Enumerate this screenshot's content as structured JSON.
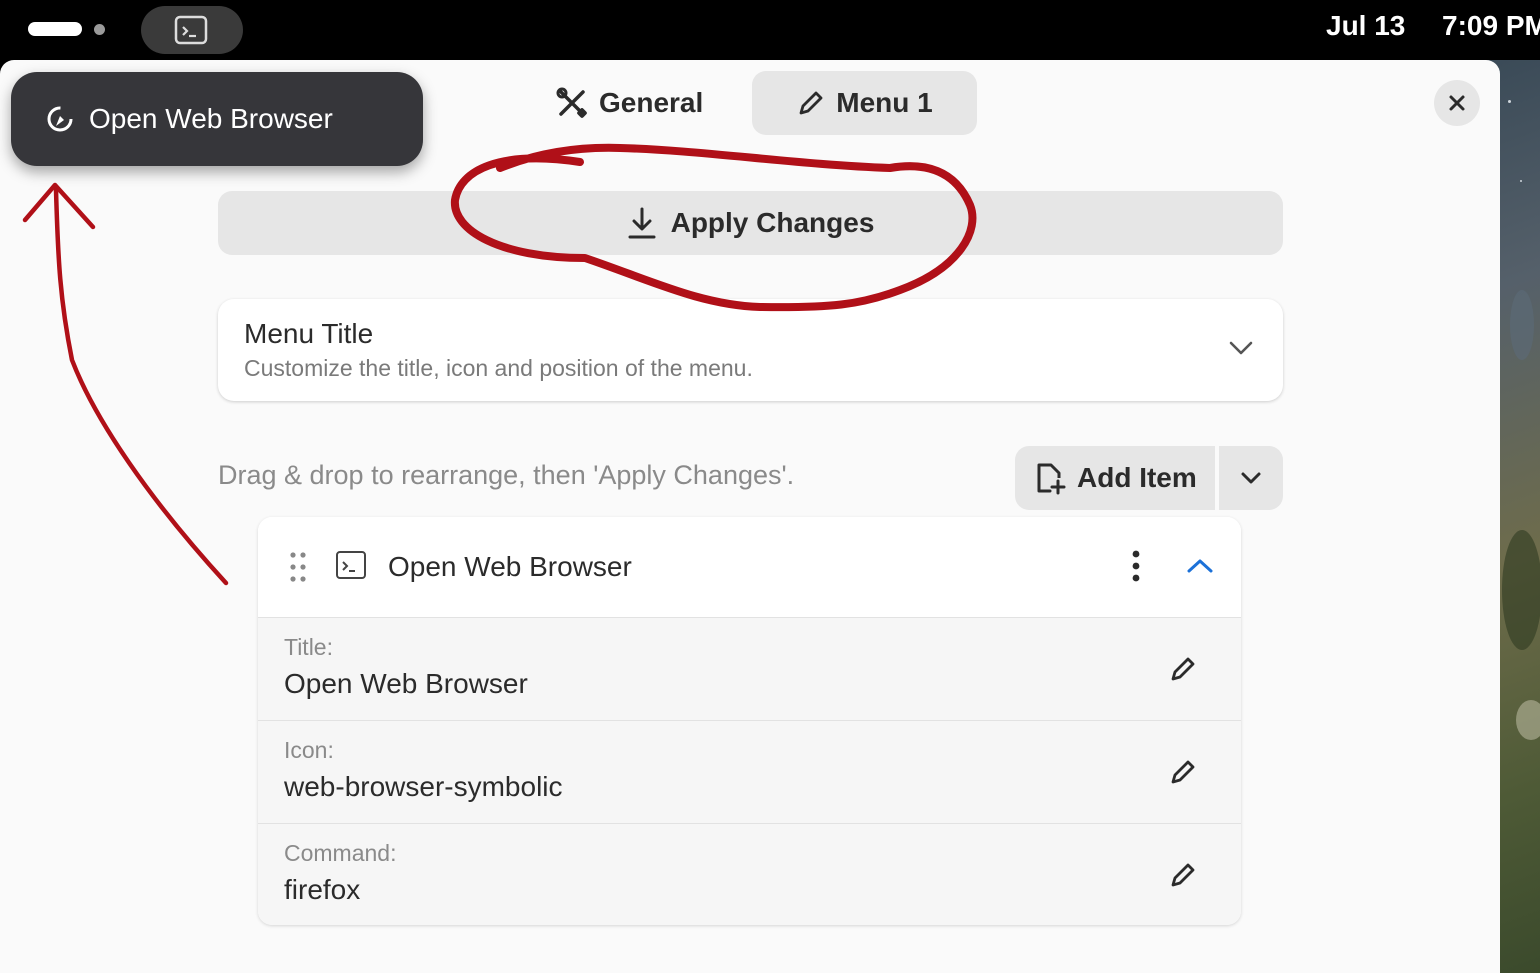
{
  "topbar": {
    "clock_date": "Jul 13",
    "clock_time": "7:09 PM"
  },
  "tabs": {
    "general": "General",
    "menu1": "Menu 1"
  },
  "apply_button": "Apply Changes",
  "menu_title_section": {
    "title": "Menu Title",
    "subtitle": "Customize the title, icon and position of the menu."
  },
  "hint": "Drag & drop to rearrange, then 'Apply Changes'.",
  "add_item": {
    "label": "Add Item"
  },
  "item": {
    "name": "Open Web Browser",
    "properties": [
      {
        "label": "Title:",
        "value": "Open Web Browser"
      },
      {
        "label": "Icon:",
        "value": "web-browser-symbolic"
      },
      {
        "label": "Command:",
        "value": "firefox"
      }
    ]
  },
  "preview": {
    "label": "Open Web Browser"
  },
  "colors": {
    "annotation": "#b01018",
    "accent": "#1c71d8",
    "window_bg": "#fafafa",
    "button_bg": "#e6e6e6",
    "preview_bg": "#36363a"
  }
}
